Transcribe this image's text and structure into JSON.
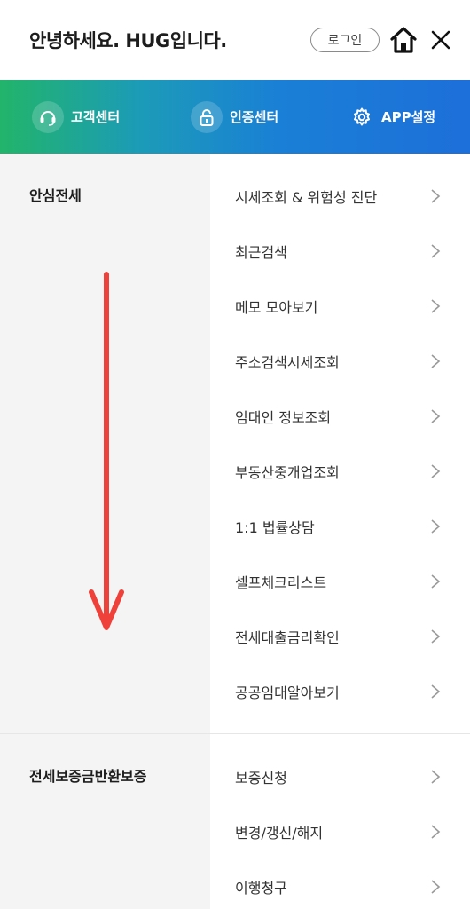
{
  "header": {
    "greeting": "안녕하세요. HUG입니다.",
    "login_label": "로그인"
  },
  "quickbar": {
    "items": [
      {
        "label": "고객센터",
        "icon": "headset-icon"
      },
      {
        "label": "인증센터",
        "icon": "lock-icon"
      },
      {
        "label": "APP설정",
        "icon": "gear-icon"
      }
    ]
  },
  "sections": [
    {
      "title": "안심전세",
      "items": [
        "시세조회 & 위험성 진단",
        "최근검색",
        "메모 모아보기",
        "주소검색시세조회",
        "임대인 정보조회",
        "부동산중개업조회",
        "1:1 법률상담",
        "셀프체크리스트",
        "전세대출금리확인",
        "공공임대알아보기"
      ]
    },
    {
      "title": "전세보증금반환보증",
      "items": [
        "보증신청",
        "변경/갱신/해지",
        "이행청구"
      ]
    }
  ],
  "colors": {
    "arrow": "#f0403a",
    "gradient_start": "#22b46a",
    "gradient_end": "#1d6fd9"
  }
}
